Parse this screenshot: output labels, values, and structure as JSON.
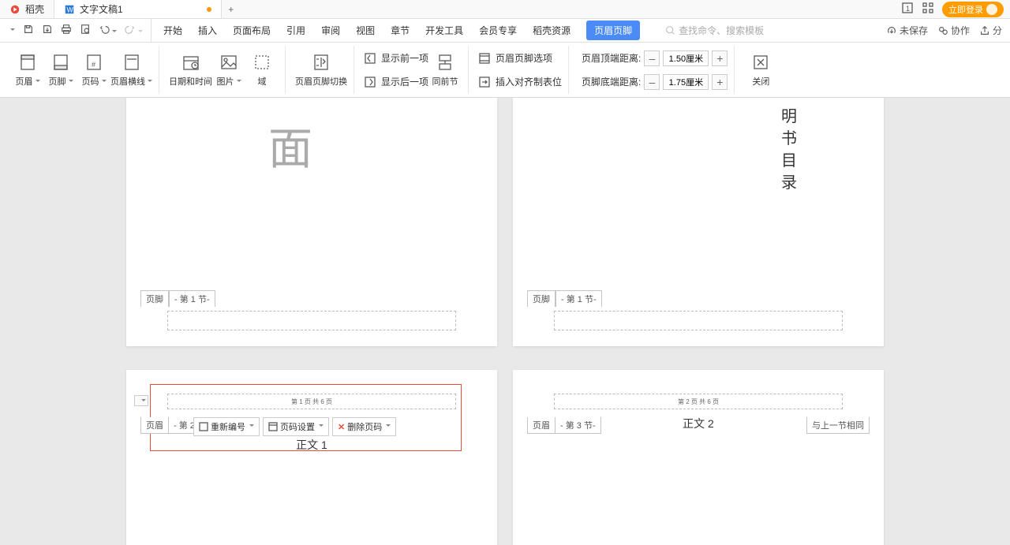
{
  "tabs": {
    "daoke": "稻壳",
    "doc1": "文字文稿1"
  },
  "login": "立即登录",
  "qat": {
    "undo": "↶",
    "redo": "↷"
  },
  "menus": {
    "start": "开始",
    "insert": "插入",
    "layout": "页面布局",
    "ref": "引用",
    "review": "审阅",
    "view": "视图",
    "section": "章节",
    "devtools": "开发工具",
    "member": "会员专享",
    "daoke_res": "稻壳资源",
    "hf": "页眉页脚"
  },
  "search_placeholder": "查找命令、搜索模板",
  "right": {
    "unsaved": "未保存",
    "coop": "协作",
    "share": "分"
  },
  "ribbon": {
    "header": "页眉",
    "footer": "页脚",
    "pagenum": "页码",
    "hline": "页眉横线",
    "datetime": "日期和时间",
    "picture": "图片",
    "field": "域",
    "hfswitch": "页眉页脚切换",
    "show_prev": "显示前一项",
    "show_next": "显示后一项",
    "same_sec": "同前节",
    "hf_options": "页眉页脚选项",
    "insert_align_tab": "插入对齐制表位",
    "header_top_dist": "页眉顶端距离:",
    "footer_bot_dist": "页脚底端距离:",
    "header_val": "1.50厘米",
    "footer_val": "1.75厘米",
    "close": "关闭"
  },
  "pages": {
    "big_char": "面",
    "p2_text": [
      "明",
      "书",
      "目",
      "录"
    ],
    "footer_label": "页脚",
    "sec1": "- 第 1 节-",
    "header_label": "页眉",
    "sec2": "- 第 2 节-",
    "sec3": "- 第 3 节-",
    "same_prev": "与上一节相同",
    "pg_line1": "第 1 页 共 6 页",
    "pg_line2": "第 2 页 共 6 页",
    "body1": "正文 1",
    "body2": "正文 2"
  },
  "popup": {
    "renumber": "重新编号",
    "pgnum_settings": "页码设置",
    "del_pgnum": "删除页码"
  }
}
